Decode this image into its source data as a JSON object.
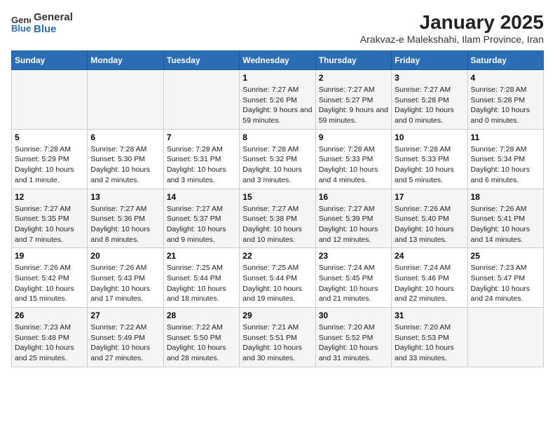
{
  "logo": {
    "text_general": "General",
    "text_blue": "Blue"
  },
  "title": "January 2025",
  "subtitle": "Arakvaz-e Malekshahi, Ilam Province, Iran",
  "days_of_week": [
    "Sunday",
    "Monday",
    "Tuesday",
    "Wednesday",
    "Thursday",
    "Friday",
    "Saturday"
  ],
  "weeks": [
    [
      {
        "day": "",
        "info": ""
      },
      {
        "day": "",
        "info": ""
      },
      {
        "day": "",
        "info": ""
      },
      {
        "day": "1",
        "info": "Sunrise: 7:27 AM\nSunset: 5:26 PM\nDaylight: 9 hours and 59 minutes."
      },
      {
        "day": "2",
        "info": "Sunrise: 7:27 AM\nSunset: 5:27 PM\nDaylight: 9 hours and 59 minutes."
      },
      {
        "day": "3",
        "info": "Sunrise: 7:27 AM\nSunset: 5:28 PM\nDaylight: 10 hours and 0 minutes."
      },
      {
        "day": "4",
        "info": "Sunrise: 7:28 AM\nSunset: 5:28 PM\nDaylight: 10 hours and 0 minutes."
      }
    ],
    [
      {
        "day": "5",
        "info": "Sunrise: 7:28 AM\nSunset: 5:29 PM\nDaylight: 10 hours and 1 minute."
      },
      {
        "day": "6",
        "info": "Sunrise: 7:28 AM\nSunset: 5:30 PM\nDaylight: 10 hours and 2 minutes."
      },
      {
        "day": "7",
        "info": "Sunrise: 7:28 AM\nSunset: 5:31 PM\nDaylight: 10 hours and 3 minutes."
      },
      {
        "day": "8",
        "info": "Sunrise: 7:28 AM\nSunset: 5:32 PM\nDaylight: 10 hours and 3 minutes."
      },
      {
        "day": "9",
        "info": "Sunrise: 7:28 AM\nSunset: 5:33 PM\nDaylight: 10 hours and 4 minutes."
      },
      {
        "day": "10",
        "info": "Sunrise: 7:28 AM\nSunset: 5:33 PM\nDaylight: 10 hours and 5 minutes."
      },
      {
        "day": "11",
        "info": "Sunrise: 7:28 AM\nSunset: 5:34 PM\nDaylight: 10 hours and 6 minutes."
      }
    ],
    [
      {
        "day": "12",
        "info": "Sunrise: 7:27 AM\nSunset: 5:35 PM\nDaylight: 10 hours and 7 minutes."
      },
      {
        "day": "13",
        "info": "Sunrise: 7:27 AM\nSunset: 5:36 PM\nDaylight: 10 hours and 8 minutes."
      },
      {
        "day": "14",
        "info": "Sunrise: 7:27 AM\nSunset: 5:37 PM\nDaylight: 10 hours and 9 minutes."
      },
      {
        "day": "15",
        "info": "Sunrise: 7:27 AM\nSunset: 5:38 PM\nDaylight: 10 hours and 10 minutes."
      },
      {
        "day": "16",
        "info": "Sunrise: 7:27 AM\nSunset: 5:39 PM\nDaylight: 10 hours and 12 minutes."
      },
      {
        "day": "17",
        "info": "Sunrise: 7:26 AM\nSunset: 5:40 PM\nDaylight: 10 hours and 13 minutes."
      },
      {
        "day": "18",
        "info": "Sunrise: 7:26 AM\nSunset: 5:41 PM\nDaylight: 10 hours and 14 minutes."
      }
    ],
    [
      {
        "day": "19",
        "info": "Sunrise: 7:26 AM\nSunset: 5:42 PM\nDaylight: 10 hours and 15 minutes."
      },
      {
        "day": "20",
        "info": "Sunrise: 7:26 AM\nSunset: 5:43 PM\nDaylight: 10 hours and 17 minutes."
      },
      {
        "day": "21",
        "info": "Sunrise: 7:25 AM\nSunset: 5:44 PM\nDaylight: 10 hours and 18 minutes."
      },
      {
        "day": "22",
        "info": "Sunrise: 7:25 AM\nSunset: 5:44 PM\nDaylight: 10 hours and 19 minutes."
      },
      {
        "day": "23",
        "info": "Sunrise: 7:24 AM\nSunset: 5:45 PM\nDaylight: 10 hours and 21 minutes."
      },
      {
        "day": "24",
        "info": "Sunrise: 7:24 AM\nSunset: 5:46 PM\nDaylight: 10 hours and 22 minutes."
      },
      {
        "day": "25",
        "info": "Sunrise: 7:23 AM\nSunset: 5:47 PM\nDaylight: 10 hours and 24 minutes."
      }
    ],
    [
      {
        "day": "26",
        "info": "Sunrise: 7:23 AM\nSunset: 5:48 PM\nDaylight: 10 hours and 25 minutes."
      },
      {
        "day": "27",
        "info": "Sunrise: 7:22 AM\nSunset: 5:49 PM\nDaylight: 10 hours and 27 minutes."
      },
      {
        "day": "28",
        "info": "Sunrise: 7:22 AM\nSunset: 5:50 PM\nDaylight: 10 hours and 28 minutes."
      },
      {
        "day": "29",
        "info": "Sunrise: 7:21 AM\nSunset: 5:51 PM\nDaylight: 10 hours and 30 minutes."
      },
      {
        "day": "30",
        "info": "Sunrise: 7:20 AM\nSunset: 5:52 PM\nDaylight: 10 hours and 31 minutes."
      },
      {
        "day": "31",
        "info": "Sunrise: 7:20 AM\nSunset: 5:53 PM\nDaylight: 10 hours and 33 minutes."
      },
      {
        "day": "",
        "info": ""
      }
    ]
  ]
}
